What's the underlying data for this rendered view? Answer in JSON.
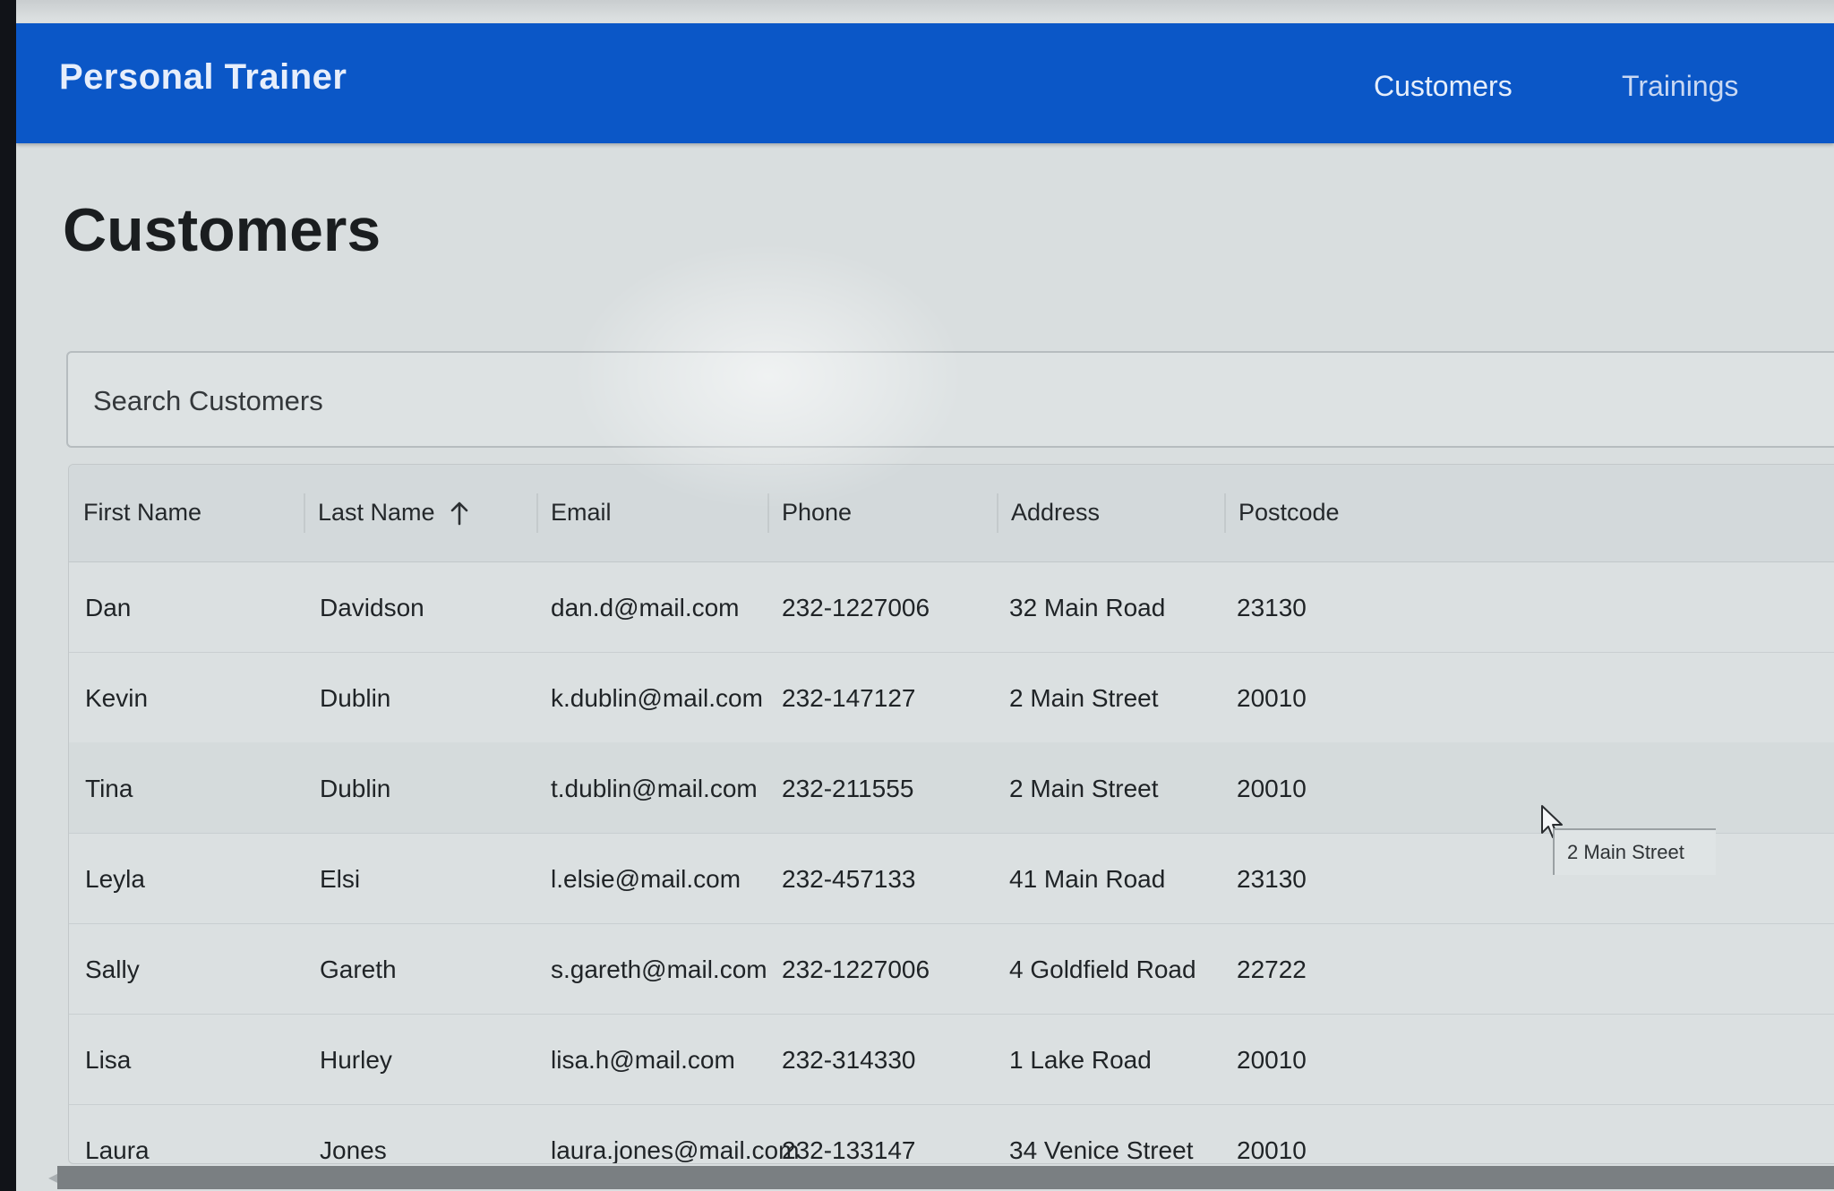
{
  "appbar": {
    "title": "Personal Trainer",
    "nav": [
      {
        "label": "Customers"
      },
      {
        "label": "Trainings"
      }
    ]
  },
  "page": {
    "title": "Customers"
  },
  "search": {
    "placeholder": "Search Customers",
    "value": ""
  },
  "table": {
    "columns": [
      "First Name",
      "Last Name",
      "Email",
      "Phone",
      "Address",
      "Postcode"
    ],
    "sorted_column": "Last Name",
    "sort_direction": "ascending",
    "rows": [
      [
        "Dan",
        "Davidson",
        "dan.d@mail.com",
        "232-1227006",
        "32 Main Road",
        "23130"
      ],
      [
        "Kevin",
        "Dublin",
        "k.dublin@mail.com",
        "232-147127",
        "2 Main Street",
        "20010"
      ],
      [
        "Tina",
        "Dublin",
        "t.dublin@mail.com",
        "232-211555",
        "2 Main Street",
        "20010"
      ],
      [
        "Leyla",
        "Elsi",
        "l.elsie@mail.com",
        "232-457133",
        "41 Main Road",
        "23130"
      ],
      [
        "Sally",
        "Gareth",
        "s.gareth@mail.com",
        "232-1227006",
        "4 Goldfield Road",
        "22722"
      ],
      [
        "Lisa",
        "Hurley",
        "lisa.h@mail.com",
        "232-314330",
        "1 Lake Road",
        "20010"
      ],
      [
        "Laura",
        "Jones",
        "laura.jones@mail.com",
        "232-133147",
        "34 Venice Street",
        "20010"
      ]
    ]
  },
  "tooltip": {
    "text": "2 Main Street"
  },
  "icons": {
    "sort": "arrow-up-icon",
    "cursor": "mouse-pointer-icon",
    "scroll_left": "chevron-left-icon"
  },
  "colors": {
    "appbar": "#0b57c7",
    "page_background": "#d9dedf"
  }
}
